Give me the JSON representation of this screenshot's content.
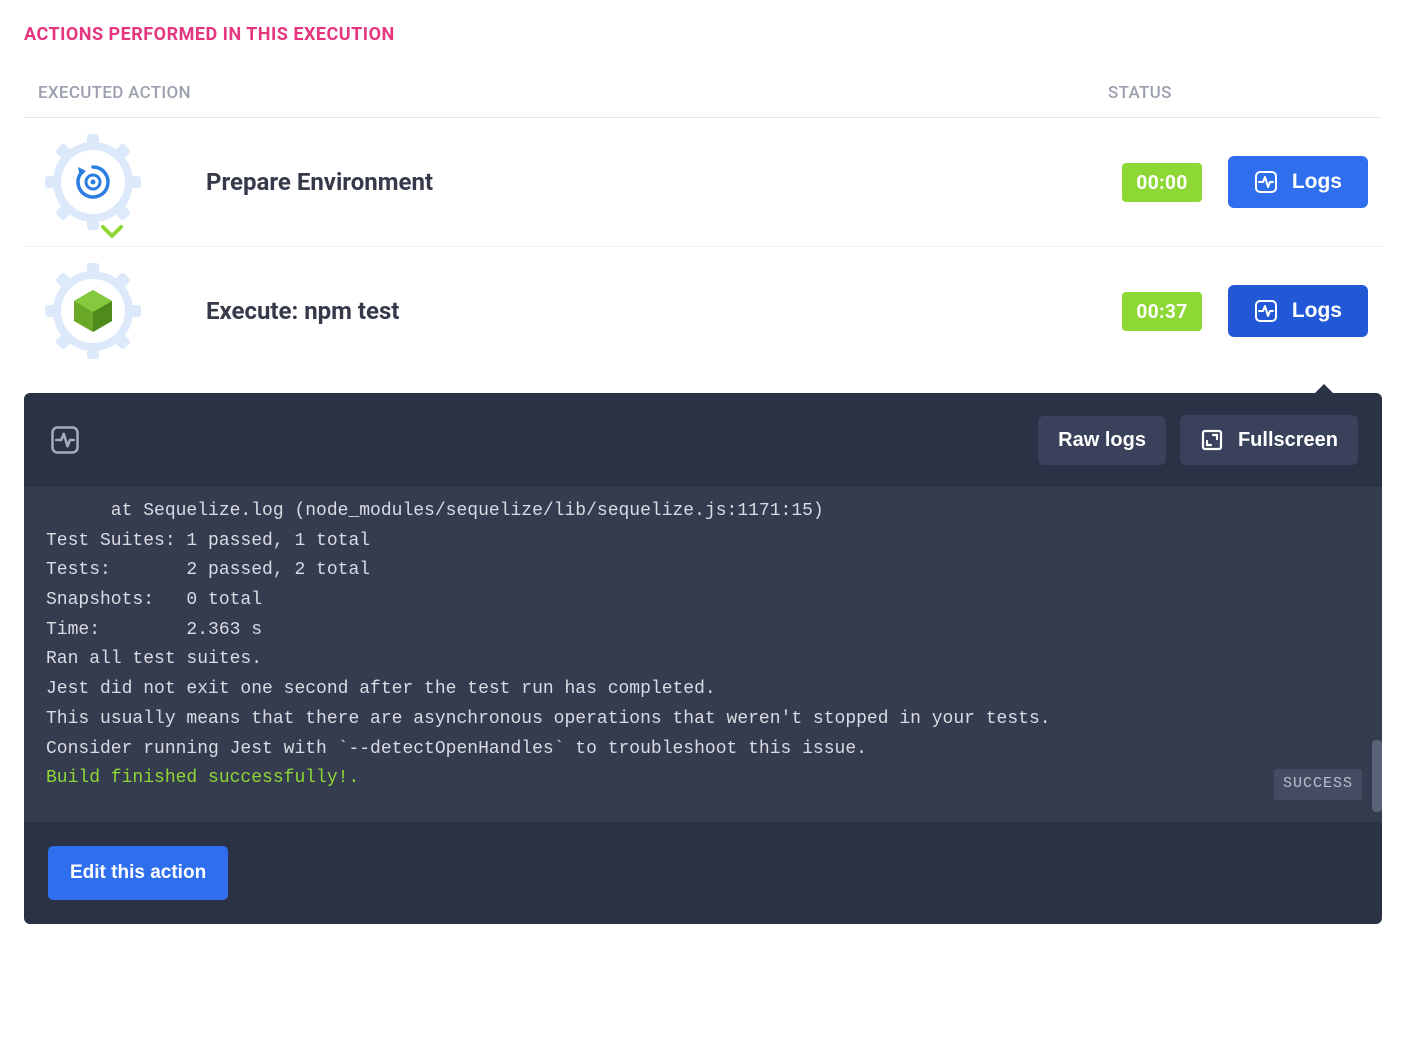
{
  "heading": "ACTIONS PERFORMED IN THIS EXECUTION",
  "columns": {
    "action": "EXECUTED ACTION",
    "status": "STATUS"
  },
  "rows": [
    {
      "title": "Prepare Environment",
      "time": "00:00",
      "logs_label": "Logs",
      "icon": "settings-refresh"
    },
    {
      "title": "Execute: npm test",
      "time": "00:37",
      "logs_label": "Logs",
      "icon": "node"
    }
  ],
  "console": {
    "toolbar": {
      "raw": "Raw logs",
      "fullscreen": "Fullscreen"
    },
    "lines": [
      "      at Sequelize.log (node_modules/sequelize/lib/sequelize.js:1171:15)",
      "Test Suites: 1 passed, 1 total",
      "Tests:       2 passed, 2 total",
      "Snapshots:   0 total",
      "Time:        2.363 s",
      "Ran all test suites.",
      "Jest did not exit one second after the test run has completed.",
      "This usually means that there are asynchronous operations that weren't stopped in your tests.",
      "Consider running Jest with `--detectOpenHandles` to troubleshoot this issue."
    ],
    "success_line": "Build finished successfully!.",
    "status_tag": "SUCCESS",
    "edit_label": "Edit this action"
  }
}
